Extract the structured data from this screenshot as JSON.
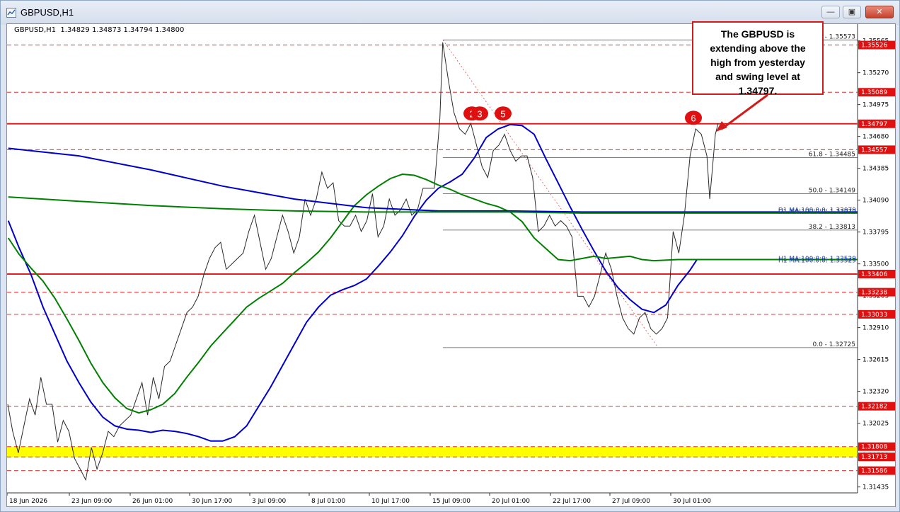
{
  "window": {
    "title": "GBPUSD,H1",
    "controls": [
      "minimize",
      "restore",
      "close"
    ]
  },
  "chart_info": "GBPUSD,H1  1.34829 1.34873 1.34794 1.34800",
  "annotation": {
    "lines": [
      "The GBPUSD is",
      "extending above the",
      "high from yesterday",
      "and swing level at",
      "1.34797."
    ]
  },
  "chart_data": {
    "type": "line",
    "instrument": "GBPUSD",
    "timeframe": "H1",
    "ohlc_current": {
      "open": 1.34829,
      "high": 1.34873,
      "low": 1.34794,
      "close": 1.348
    },
    "x_tick_labels": [
      "18 Jun 2026",
      "23 Jun 09:00",
      "26 Jun 01:00",
      "30 Jun 17:00",
      "3 Jul 09:00",
      "8 Jul 01:00",
      "10 Jul 17:00",
      "15 Jul 09:00",
      "20 Jul 01:00",
      "22 Jul 17:00",
      "27 Jul 09:00",
      "30 Jul 01:00"
    ],
    "y_tick_labels": [
      "1.35565",
      "1.35270",
      "1.34975",
      "1.34680",
      "1.34385",
      "1.34090",
      "1.33795",
      "1.33500",
      "1.33205",
      "1.32910",
      "1.32615",
      "1.32320",
      "1.32025",
      "1.31730",
      "1.31435"
    ],
    "ylim": [
      1.3138,
      1.3572
    ],
    "price_levels": [
      {
        "value": "1.35526",
        "color": "#e03030",
        "style": "dashed"
      },
      {
        "value": "1.35089",
        "color": "#e03030",
        "style": "dashed"
      },
      {
        "value": "1.34797",
        "color": "#e02020",
        "style": "solid"
      },
      {
        "value": "1.34557",
        "color": "#e03030",
        "style": "dashed"
      },
      {
        "value": "1.33406",
        "color": "#e02020",
        "style": "solid"
      },
      {
        "value": "1.33238",
        "color": "#e03030",
        "style": "dashed"
      },
      {
        "value": "1.33033",
        "color": "#e03030",
        "style": "dashed"
      },
      {
        "value": "1.32182",
        "color": "#e03030",
        "style": "dashed"
      },
      {
        "value": "1.31808",
        "color": "#e03030",
        "style": "dashed"
      },
      {
        "value": "1.31713",
        "color": "#e03030",
        "style": "dashed"
      },
      {
        "value": "1.31586",
        "color": "#e03030",
        "style": "dashed"
      }
    ],
    "support_zone": {
      "from": 1.31713,
      "to": 1.31808,
      "color": "#ffff00"
    },
    "fibonacci": [
      {
        "label": "0.0 - 1.35573",
        "value": 1.35573
      },
      {
        "label": "61.8 - 1.34485",
        "value": 1.34485
      },
      {
        "label": "50.0 - 1.34149",
        "value": 1.34149
      },
      {
        "label": "38.2 - 1.33813",
        "value": 1.33813
      },
      {
        "label": "0.0 - 1.32725",
        "value": 1.32725
      }
    ],
    "ma_labels": [
      {
        "text": "D1 MA:100:0:0: 1.33979",
        "value": 1.33979
      },
      {
        "text": "D1 MA:100:0:0: 1.33979",
        "value": 1.33965
      },
      {
        "text": "H1 MA:100:0:0: 1.33529",
        "value": 1.33529
      },
      {
        "text": "H1 MA:100:0:0: 1.33529",
        "value": 1.33515
      }
    ],
    "swing_markers": [
      "2",
      "3",
      "5",
      "6"
    ],
    "series": [
      {
        "color": "#0000cc",
        "values": [
          [
            1,
            1.339
          ],
          [
            10,
            1.3365
          ],
          [
            20,
            1.334
          ],
          [
            30,
            1.331
          ],
          [
            40,
            1.3285
          ],
          [
            50,
            1.326
          ],
          [
            60,
            1.324
          ],
          [
            70,
            1.3222
          ],
          [
            80,
            1.3208
          ],
          [
            90,
            1.32
          ],
          [
            100,
            1.3197
          ],
          [
            110,
            1.3196
          ],
          [
            120,
            1.3194
          ],
          [
            130,
            1.3196
          ],
          [
            140,
            1.3195
          ],
          [
            150,
            1.3193
          ],
          [
            160,
            1.319
          ],
          [
            170,
            1.3186
          ],
          [
            180,
            1.3186
          ],
          [
            190,
            1.319
          ],
          [
            200,
            1.32
          ],
          [
            210,
            1.3218
          ],
          [
            220,
            1.3236
          ],
          [
            230,
            1.3256
          ],
          [
            240,
            1.3276
          ],
          [
            250,
            1.3296
          ],
          [
            260,
            1.331
          ],
          [
            270,
            1.3321
          ],
          [
            280,
            1.3326
          ],
          [
            290,
            1.333
          ],
          [
            300,
            1.3336
          ],
          [
            310,
            1.3348
          ],
          [
            320,
            1.3361
          ],
          [
            330,
            1.3376
          ],
          [
            340,
            1.3394
          ],
          [
            350,
            1.3409
          ],
          [
            360,
            1.342
          ],
          [
            370,
            1.3426
          ],
          [
            380,
            1.3433
          ],
          [
            390,
            1.3448
          ],
          [
            400,
            1.3467
          ],
          [
            410,
            1.3475
          ],
          [
            420,
            1.3479
          ],
          [
            430,
            1.3478
          ],
          [
            440,
            1.347
          ],
          [
            450,
            1.3447
          ],
          [
            460,
            1.3425
          ],
          [
            470,
            1.3403
          ],
          [
            480,
            1.3382
          ],
          [
            490,
            1.3362
          ],
          [
            500,
            1.3343
          ],
          [
            510,
            1.3328
          ],
          [
            520,
            1.3317
          ],
          [
            530,
            1.3308
          ],
          [
            540,
            1.3305
          ],
          [
            550,
            1.3312
          ],
          [
            560,
            1.333
          ],
          [
            570,
            1.3344
          ],
          [
            576,
            1.3354
          ],
          [
            600,
            1.3354
          ],
          [
            640,
            1.3354
          ],
          [
            680,
            1.3354
          ],
          [
            710,
            1.3354
          ]
        ]
      },
      {
        "color": "#008000",
        "values": [
          [
            1,
            1.3374
          ],
          [
            10,
            1.3359
          ],
          [
            20,
            1.3346
          ],
          [
            30,
            1.3334
          ],
          [
            40,
            1.3318
          ],
          [
            50,
            1.3299
          ],
          [
            60,
            1.3279
          ],
          [
            70,
            1.3258
          ],
          [
            80,
            1.324
          ],
          [
            90,
            1.3226
          ],
          [
            100,
            1.3216
          ],
          [
            110,
            1.3212
          ],
          [
            120,
            1.3215
          ],
          [
            130,
            1.322
          ],
          [
            140,
            1.323
          ],
          [
            150,
            1.3245
          ],
          [
            160,
            1.3259
          ],
          [
            170,
            1.3274
          ],
          [
            180,
            1.3286
          ],
          [
            190,
            1.3298
          ],
          [
            200,
            1.331
          ],
          [
            210,
            1.3318
          ],
          [
            220,
            1.3325
          ],
          [
            230,
            1.3332
          ],
          [
            240,
            1.3342
          ],
          [
            250,
            1.3351
          ],
          [
            260,
            1.3361
          ],
          [
            270,
            1.3374
          ],
          [
            280,
            1.3389
          ],
          [
            290,
            1.3404
          ],
          [
            300,
            1.3414
          ],
          [
            310,
            1.3422
          ],
          [
            320,
            1.3429
          ],
          [
            330,
            1.3433
          ],
          [
            340,
            1.3432
          ],
          [
            350,
            1.3428
          ],
          [
            360,
            1.3423
          ],
          [
            370,
            1.3419
          ],
          [
            380,
            1.3414
          ],
          [
            390,
            1.341
          ],
          [
            400,
            1.3406
          ],
          [
            410,
            1.3403
          ],
          [
            420,
            1.3398
          ],
          [
            430,
            1.3389
          ],
          [
            440,
            1.3374
          ],
          [
            450,
            1.3364
          ],
          [
            460,
            1.3354
          ],
          [
            470,
            1.3353
          ],
          [
            480,
            1.3355
          ],
          [
            490,
            1.3357
          ],
          [
            500,
            1.3355
          ],
          [
            510,
            1.3356
          ],
          [
            520,
            1.3357
          ],
          [
            530,
            1.3354
          ],
          [
            540,
            1.3353
          ],
          [
            560,
            1.3354
          ],
          [
            576,
            1.3354
          ],
          [
            640,
            1.3354
          ],
          [
            710,
            1.3354
          ]
        ]
      },
      {
        "color": "#0000cc",
        "values": [
          [
            1,
            1.3457
          ],
          [
            60,
            1.345
          ],
          [
            120,
            1.3437
          ],
          [
            180,
            1.3422
          ],
          [
            240,
            1.341
          ],
          [
            300,
            1.3402
          ],
          [
            360,
            1.3399
          ],
          [
            420,
            1.3399
          ],
          [
            480,
            1.3398
          ],
          [
            540,
            1.3398
          ],
          [
            580,
            1.3398
          ],
          [
            650,
            1.3398
          ],
          [
            710,
            1.3398
          ]
        ]
      },
      {
        "color": "#008000",
        "values": [
          [
            1,
            1.3412
          ],
          [
            60,
            1.3408
          ],
          [
            120,
            1.3404
          ],
          [
            180,
            1.3401
          ],
          [
            240,
            1.3399
          ],
          [
            300,
            1.3398
          ],
          [
            360,
            1.3398
          ],
          [
            420,
            1.3398
          ],
          [
            480,
            1.3397
          ],
          [
            540,
            1.3397
          ],
          [
            580,
            1.3397
          ],
          [
            650,
            1.3397
          ],
          [
            710,
            1.3397
          ]
        ]
      }
    ]
  }
}
